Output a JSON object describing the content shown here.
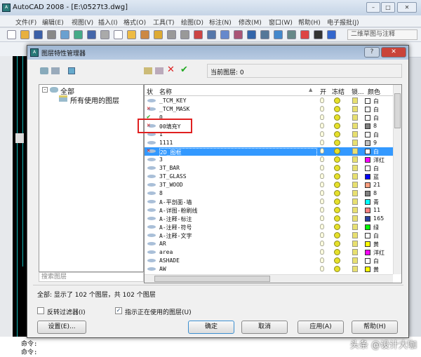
{
  "app": {
    "title": "AutoCAD 2008 - [E:\\0527t3.dwg]",
    "icon": "autocad-icon"
  },
  "menu": [
    "文件(F)",
    "编辑(E)",
    "视图(V)",
    "插入(I)",
    "格式(O)",
    "工具(T)",
    "绘图(D)",
    "标注(N)",
    "修改(M)",
    "窗口(W)",
    "帮助(H)",
    "电子报批(J)"
  ],
  "workspace": "二维草图与注释",
  "dialog": {
    "title": "图层特性管理器",
    "current_layer_label": "当前图层: 0",
    "tree": {
      "root": "全部",
      "child": "所有使用的图层"
    },
    "search_placeholder": "搜索图层",
    "columns": {
      "status": "状",
      "name": "名称",
      "on": "开",
      "freeze": "冻结",
      "lock": "锁...",
      "color": "颜色"
    },
    "layers": [
      {
        "name": "_TCM_KEY",
        "color": "白",
        "hex": "#ffffff",
        "status": "unused"
      },
      {
        "name": "_TCM_MASK",
        "color": "白",
        "hex": "#ffffff",
        "status": "delete"
      },
      {
        "name": "0",
        "color": "白",
        "hex": "#ffffff",
        "status": "current"
      },
      {
        "name": "00填充Y",
        "color": "8",
        "hex": "#808080",
        "status": "delete"
      },
      {
        "name": "1",
        "color": "白",
        "hex": "#ffffff",
        "status": "unused"
      },
      {
        "name": "1111",
        "color": "9",
        "hex": "#c0c0c0",
        "status": "used"
      },
      {
        "name": "2D_图框",
        "color": "白",
        "hex": "#ffffff",
        "status": "delete",
        "selected": true
      },
      {
        "name": "3",
        "color": "洋红",
        "hex": "#ff00ff",
        "status": "unused"
      },
      {
        "name": "3T_BAR",
        "color": "白",
        "hex": "#ffffff",
        "status": "used"
      },
      {
        "name": "3T_GLASS",
        "color": "蓝",
        "hex": "#0000ff",
        "status": "used"
      },
      {
        "name": "3T_WOOD",
        "color": "21",
        "hex": "#ff9f7f",
        "status": "used"
      },
      {
        "name": "8",
        "color": "8",
        "hex": "#808080",
        "status": "used"
      },
      {
        "name": "A-平剖面-墙",
        "color": "青",
        "hex": "#00ffff",
        "status": "unused"
      },
      {
        "name": "A-详图-粉刷线",
        "color": "11",
        "hex": "#ff7f7f",
        "status": "unused"
      },
      {
        "name": "A-注释-标注",
        "color": "165",
        "hex": "#2a3f9f",
        "status": "used"
      },
      {
        "name": "A-注释-符号",
        "color": "绿",
        "hex": "#00ff00",
        "status": "unused"
      },
      {
        "name": "A-注释-文字",
        "color": "白",
        "hex": "#ffffff",
        "status": "unused"
      },
      {
        "name": "AR",
        "color": "黄",
        "hex": "#ffff00",
        "status": "unused"
      },
      {
        "name": "area",
        "color": "洋红",
        "hex": "#ff00ff",
        "status": "unused"
      },
      {
        "name": "ASHADE",
        "color": "白",
        "hex": "#ffffff",
        "status": "used"
      },
      {
        "name": "AW",
        "color": "黄",
        "hex": "#ffff00",
        "status": "unused"
      }
    ],
    "status_text": "全部: 显示了 102 个图层，共 102 个图层",
    "invert_filter": {
      "label": "反转过滤器(I)",
      "checked": false
    },
    "indicate_used": {
      "label": "指示正在使用的图层(U)",
      "checked": true
    },
    "buttons": {
      "settings": "设置(E)...",
      "ok": "确定",
      "cancel": "取消",
      "apply": "应用(A)",
      "help": "帮助(H)"
    }
  },
  "command_lines": [
    "命令:",
    "命令:"
  ],
  "watermark": "头条 @设计大咖"
}
